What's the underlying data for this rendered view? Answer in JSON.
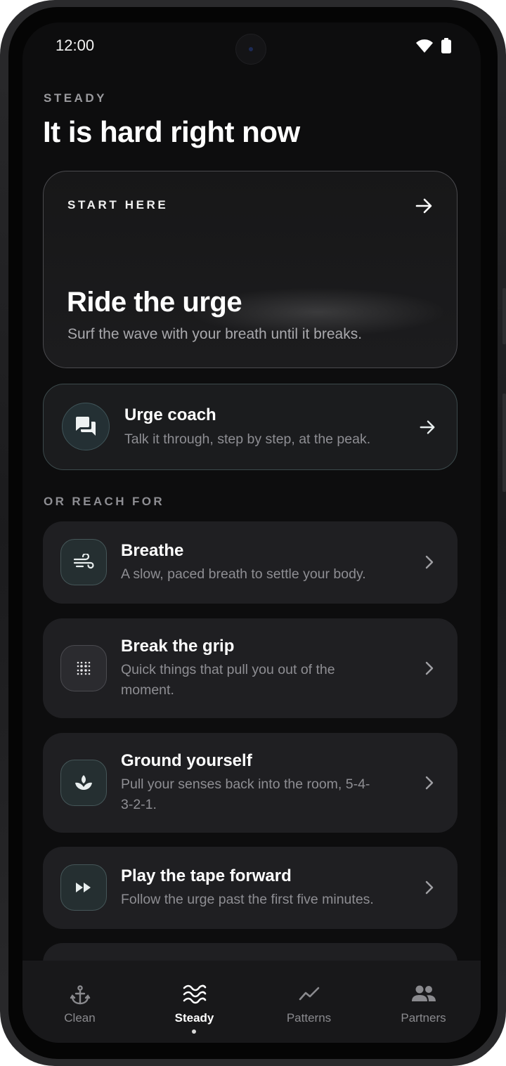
{
  "status": {
    "time": "12:00",
    "icons": [
      "wifi-icon",
      "battery-icon"
    ]
  },
  "header": {
    "eyebrow": "STEADY",
    "title": "It is hard right now"
  },
  "hero": {
    "eyebrow": "START HERE",
    "title": "Ride the urge",
    "subtitle": "Surf the wave with your breath until it breaks.",
    "icon": "arrow-right-icon"
  },
  "coach": {
    "title": "Urge coach",
    "subtitle": "Talk it through, step by step, at the peak.",
    "icon": "chat-bubbles-icon"
  },
  "section": {
    "label": "OR REACH FOR"
  },
  "tools": [
    {
      "title": "Breathe",
      "subtitle": "A slow, paced breath to settle your body.",
      "icon": "wind-icon"
    },
    {
      "title": "Break the grip",
      "subtitle": "Quick things that pull you out of the moment.",
      "icon": "dot-grid-icon"
    },
    {
      "title": "Ground yourself",
      "subtitle": "Pull your senses back into the room, 5-4-3-2-1.",
      "icon": "lotus-icon"
    },
    {
      "title": "Play the tape forward",
      "subtitle": "Follow the urge past the first five minutes.",
      "icon": "fast-forward-icon"
    }
  ],
  "nav": {
    "items": [
      {
        "label": "Clean",
        "icon": "anchor-icon",
        "active": false
      },
      {
        "label": "Steady",
        "icon": "waves-icon",
        "active": true
      },
      {
        "label": "Patterns",
        "icon": "trend-line-icon",
        "active": false
      },
      {
        "label": "Partners",
        "icon": "people-icon",
        "active": false
      }
    ]
  },
  "colors": {
    "background": "#0d0d0e",
    "card": "#1f1f22",
    "accent": "#8fb3b8",
    "text": "#ffffff",
    "muted": "#8e8e93"
  }
}
